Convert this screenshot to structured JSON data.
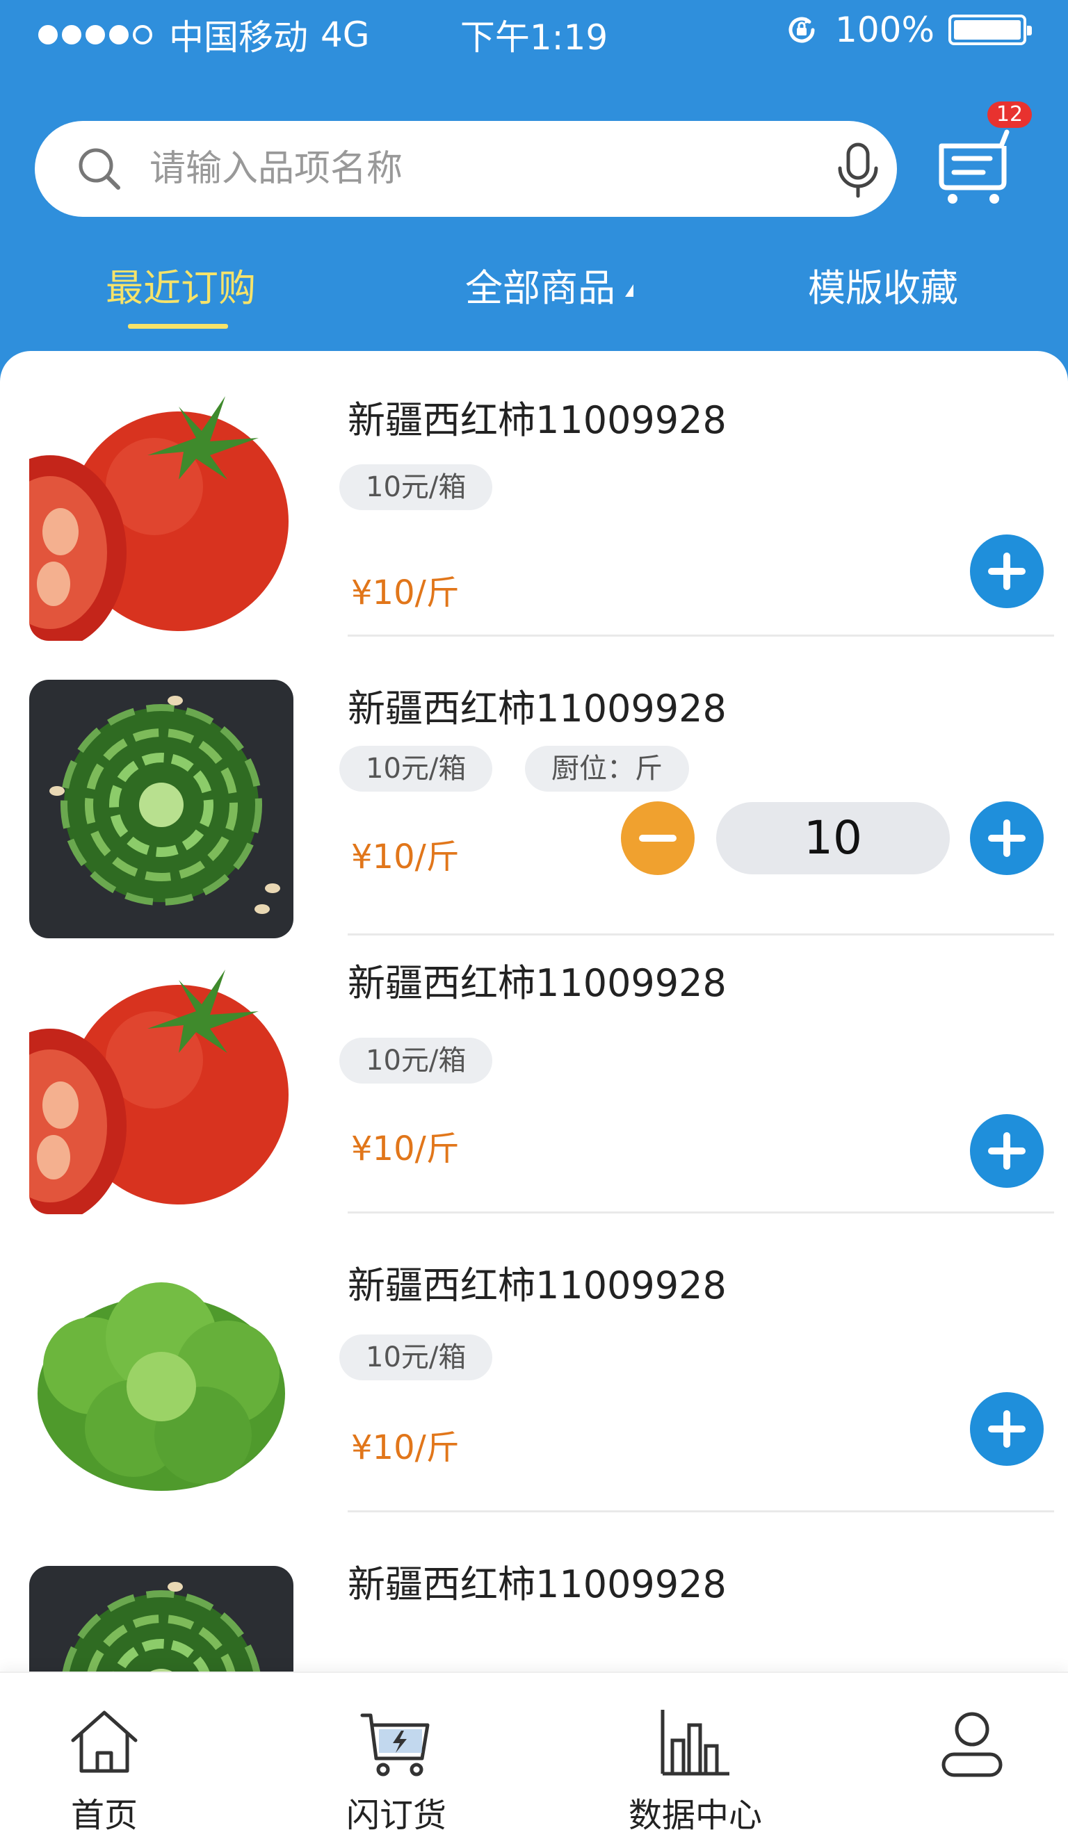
{
  "status_bar": {
    "carrier": "中国移动",
    "network": "4G",
    "time": "下午1:19",
    "battery": "100%",
    "signal_icon": "signal-dots-icon",
    "lock_icon": "rotation-lock-icon",
    "battery_icon": "battery-icon"
  },
  "search": {
    "placeholder": "请输入品项名称",
    "value": "",
    "search_icon": "search-icon",
    "mic_icon": "microphone-icon"
  },
  "cart": {
    "icon": "cart-list-icon",
    "badge": "12"
  },
  "tabs": [
    {
      "label": "最近订购",
      "active": true
    },
    {
      "label": "全部商品",
      "active": false,
      "dropdown": true
    },
    {
      "label": "模版收藏",
      "active": false
    }
  ],
  "products": [
    {
      "name": "新疆西红柿11009928",
      "tags": [
        "10元/箱"
      ],
      "price": "¥10/斤",
      "quantity": null,
      "image": "tomato"
    },
    {
      "name": "新疆西红柿11009928",
      "tags": [
        "10元/箱",
        "㕑位：斤"
      ],
      "price": "¥10/斤",
      "quantity": "10",
      "image": "rose-vegetable"
    },
    {
      "name": "新疆西红柿11009928",
      "tags": [
        "10元/箱"
      ],
      "price": "¥10/斤",
      "quantity": null,
      "image": "tomato"
    },
    {
      "name": "新疆西红柿11009928",
      "tags": [
        "10元/箱"
      ],
      "price": "¥10/斤",
      "quantity": null,
      "image": "lettuce"
    },
    {
      "name": "新疆西红柿11009928",
      "tags": [],
      "price": "",
      "quantity": null,
      "image": "rose-vegetable"
    }
  ],
  "bottom_nav": [
    {
      "label": "首页",
      "icon": "home-icon"
    },
    {
      "label": "闪订货",
      "icon": "flash-cart-icon"
    },
    {
      "label": "数据中心",
      "icon": "bar-chart-icon"
    },
    {
      "label": "",
      "icon": "user-icon"
    }
  ],
  "colors": {
    "header": "#2f8fdc",
    "active_tab": "#f6e36a",
    "price": "#e1761a",
    "plus_button": "#1f8fdb",
    "minus_button": "#f0a12f",
    "badge": "#e8322f"
  }
}
